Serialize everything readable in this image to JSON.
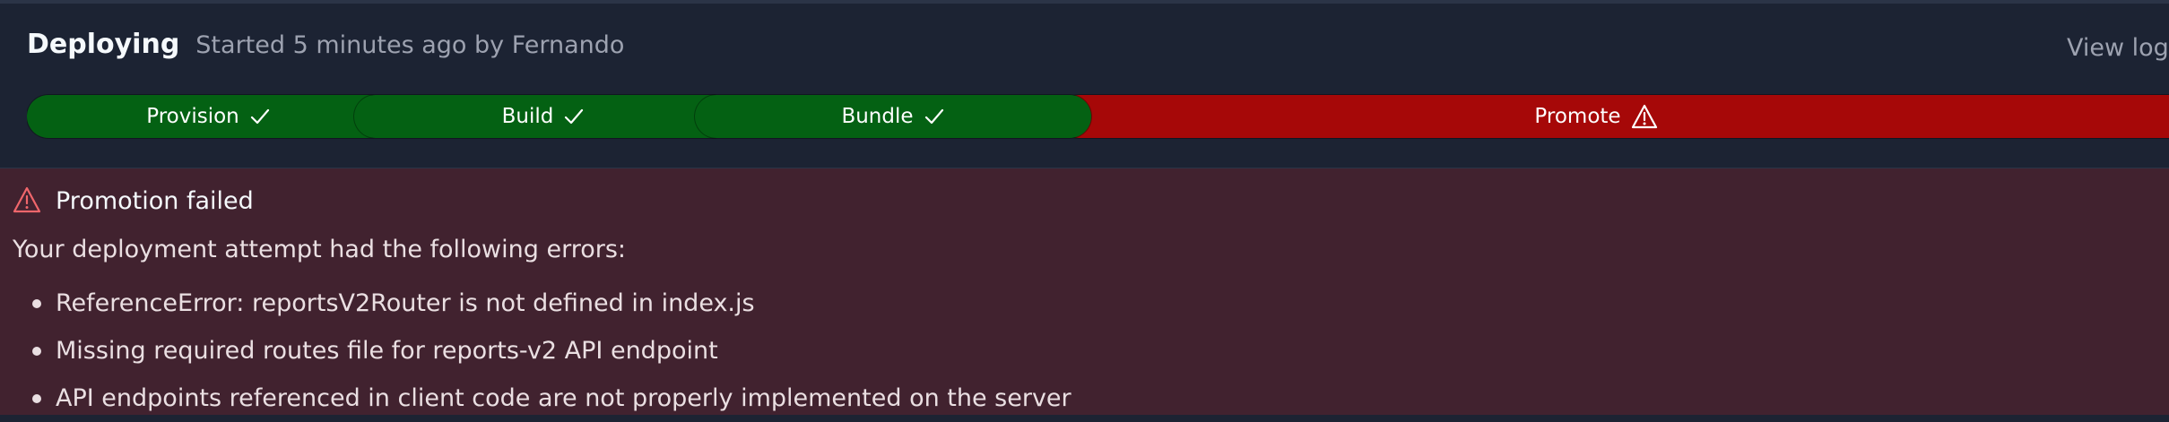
{
  "header": {
    "title": "Deploying",
    "subtitle": "Started 5 minutes ago by Fernando",
    "view_logs_label": "View logs"
  },
  "pipeline": {
    "stages": [
      {
        "label": "Provision",
        "status": "success",
        "icon": "check-icon"
      },
      {
        "label": "Build",
        "status": "success",
        "icon": "check-icon"
      },
      {
        "label": "Bundle",
        "status": "success",
        "icon": "check-icon"
      },
      {
        "label": "Promote",
        "status": "failed",
        "icon": "warning-icon"
      }
    ]
  },
  "error": {
    "icon": "warning-icon",
    "title": "Promotion failed",
    "intro": "Your deployment attempt had the following errors:",
    "items": [
      "ReferenceError: reportsV2Router is not defined in index.js",
      "Missing required routes file for reports-v2 API endpoint",
      "API endpoints referenced in client code are not properly implemented on the server"
    ]
  },
  "colors": {
    "success": "#046113",
    "failed": "#a60808",
    "panel_background": "#1c2333",
    "error_background": "#41222f",
    "error_icon": "#f0666b"
  }
}
